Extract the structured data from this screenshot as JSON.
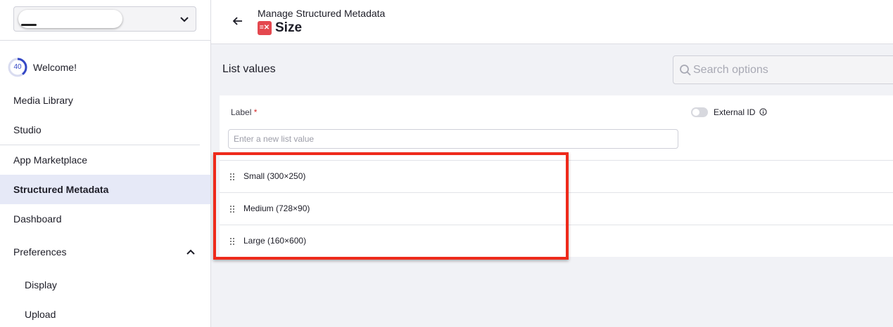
{
  "sidebar": {
    "welcome": {
      "progress": "40",
      "label": "Welcome!"
    },
    "items": [
      {
        "label": "Media Library"
      },
      {
        "label": "Studio"
      },
      {
        "label": "App Marketplace"
      },
      {
        "label": "Structured Metadata"
      },
      {
        "label": "Dashboard"
      },
      {
        "label": "Preferences"
      },
      {
        "label": "Display"
      },
      {
        "label": "Upload"
      }
    ]
  },
  "header": {
    "breadcrumb": "Manage Structured Metadata",
    "title_icon": "=✕",
    "title": "Size"
  },
  "main": {
    "section_title": "List values",
    "search_placeholder": "Search options",
    "label": "Label",
    "required_mark": "*",
    "external_id_label": "External ID",
    "new_value_placeholder": "Enter a new list value",
    "rows": [
      {
        "label": "Small (300×250)"
      },
      {
        "label": "Medium (728×90)"
      },
      {
        "label": "Large (160×600)"
      }
    ]
  },
  "colors": {
    "accent": "#3448c5",
    "active_bg": "#e6e9f7",
    "title_icon": "#e4484f",
    "highlight": "#ee2a1b"
  },
  "icons": [
    "chevron-down-icon",
    "back-arrow-icon",
    "metadata-icon",
    "search-icon",
    "info-icon",
    "drag-handle-icon",
    "chevron-up-icon"
  ]
}
